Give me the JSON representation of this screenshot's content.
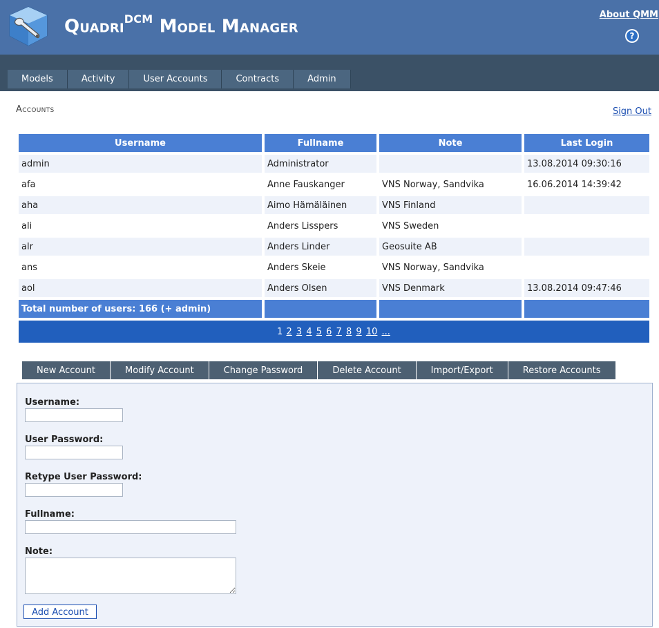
{
  "header": {
    "title_part1": "Quadri",
    "title_sup": "DCM",
    "title_part2": "Model Manager",
    "about_link": "About QMM",
    "help_icon": "?"
  },
  "nav": {
    "tabs": [
      "Models",
      "Activity",
      "User Accounts",
      "Contracts",
      "Admin"
    ]
  },
  "page": {
    "section_title": "Accounts",
    "signout": "Sign Out"
  },
  "table": {
    "headers": [
      "Username",
      "Fullname",
      "Note",
      "Last Login"
    ],
    "rows": [
      {
        "username": "admin",
        "fullname": "Administrator",
        "note": "",
        "last_login": "13.08.2014 09:30:16"
      },
      {
        "username": "afa",
        "fullname": "Anne Fauskanger",
        "note": "VNS Norway, Sandvika",
        "last_login": "16.06.2014 14:39:42"
      },
      {
        "username": "aha",
        "fullname": "Aimo Hämäläinen",
        "note": "VNS Finland",
        "last_login": ""
      },
      {
        "username": "ali",
        "fullname": "Anders Lisspers",
        "note": "VNS Sweden",
        "last_login": ""
      },
      {
        "username": "alr",
        "fullname": "Anders Linder",
        "note": "Geosuite AB",
        "last_login": ""
      },
      {
        "username": "ans",
        "fullname": "Anders Skeie",
        "note": "VNS Norway, Sandvika",
        "last_login": ""
      },
      {
        "username": "aol",
        "fullname": "Anders Olsen",
        "note": "VNS Denmark",
        "last_login": "13.08.2014 09:47:46"
      }
    ],
    "total": "Total number of users: 166 (+ admin)"
  },
  "pager": {
    "current": "1",
    "pages": [
      "2",
      "3",
      "4",
      "5",
      "6",
      "7",
      "8",
      "9",
      "10",
      "..."
    ]
  },
  "subtabs": [
    "New Account",
    "Modify Account",
    "Change Password",
    "Delete Account",
    "Import/Export",
    "Restore Accounts"
  ],
  "form": {
    "username_label": "Username:",
    "username_value": "",
    "password_label": "User Password:",
    "password_value": "",
    "retype_label": "Retype User Password:",
    "retype_value": "",
    "fullname_label": "Fullname:",
    "fullname_value": "",
    "note_label": "Note:",
    "note_value": "",
    "submit": "Add Account"
  },
  "colors": {
    "header_bg": "#4a71a8",
    "navbar_bg": "#3b5166",
    "table_header_bg": "#4a7fd4",
    "pager_bg": "#215fbd",
    "row_alt_bg": "#eef2fa",
    "link": "#1a4db0"
  }
}
